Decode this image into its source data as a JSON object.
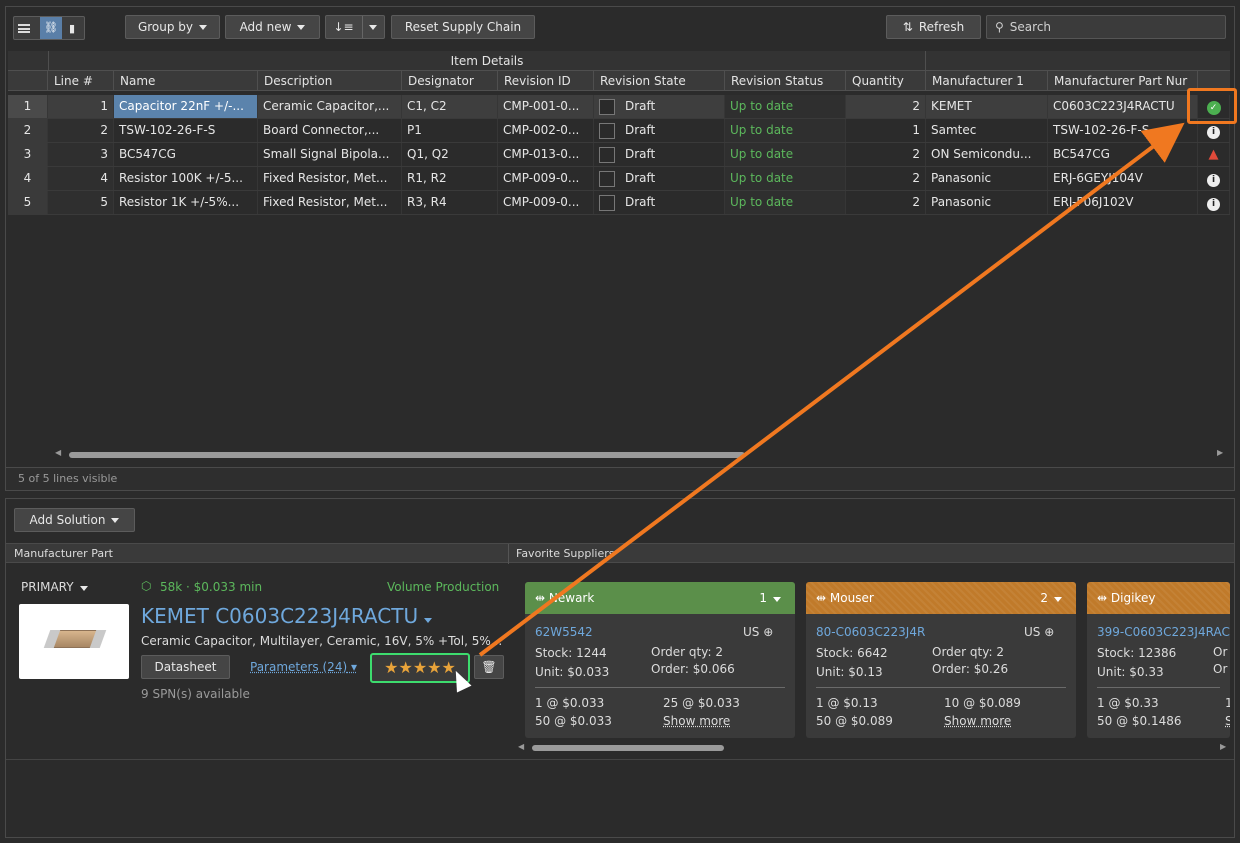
{
  "toolbar": {
    "group_by": "Group by",
    "add_new": "Add new",
    "reset": "Reset Supply Chain",
    "refresh": "Refresh",
    "search_placeholder": "Search"
  },
  "grid": {
    "group_header": "Item Details",
    "columns": [
      "Line #",
      "Name",
      "Description",
      "Designator",
      "Revision ID",
      "Revision State",
      "Revision Status",
      "Quantity",
      "Manufacturer 1",
      "Manufacturer Part Nur"
    ],
    "rows": [
      {
        "idx": "1",
        "line": "1",
        "name": "Capacitor 22nF +/-...",
        "desc": "Ceramic Capacitor,...",
        "des": "C1, C2",
        "rev": "CMP-001-0...",
        "state": "Draft",
        "status": "Up to date",
        "qty": "2",
        "mfr": "KEMET",
        "mpn": "C0603C223J4RACTU",
        "icon": "check"
      },
      {
        "idx": "2",
        "line": "2",
        "name": "TSW-102-26-F-S",
        "desc": "Board Connector,...",
        "des": "P1",
        "rev": "CMP-002-0...",
        "state": "Draft",
        "status": "Up to date",
        "qty": "1",
        "mfr": "Samtec",
        "mpn": "TSW-102-26-F-S",
        "icon": "info"
      },
      {
        "idx": "3",
        "line": "3",
        "name": "BC547CG",
        "desc": "Small Signal Bipola...",
        "des": "Q1, Q2",
        "rev": "CMP-013-0...",
        "state": "Draft",
        "status": "Up to date",
        "qty": "2",
        "mfr": "ON Semicondu...",
        "mpn": "BC547CG",
        "icon": "warning"
      },
      {
        "idx": "4",
        "line": "4",
        "name": "Resistor 100K +/-5...",
        "desc": "Fixed Resistor, Met...",
        "des": "R1, R2",
        "rev": "CMP-009-0...",
        "state": "Draft",
        "status": "Up to date",
        "qty": "2",
        "mfr": "Panasonic",
        "mpn": "ERJ-6GEYJ104V",
        "icon": "info"
      },
      {
        "idx": "5",
        "line": "5",
        "name": "Resistor 1K +/-5%...",
        "desc": "Fixed Resistor, Met...",
        "des": "R3, R4",
        "rev": "CMP-009-0...",
        "state": "Draft",
        "status": "Up to date",
        "qty": "2",
        "mfr": "Panasonic",
        "mpn": "ERJ-P06J102V",
        "icon": "info"
      }
    ],
    "footer": "5 of 5 lines visible"
  },
  "solution": {
    "add_solution": "Add Solution",
    "mfr_part_header": "Manufacturer Part",
    "suppliers_header": "Favorite Suppliers",
    "primary": "PRIMARY",
    "stock_summary": "58k · $0.033 min",
    "lifecycle": "Volume Production",
    "title": "KEMET C0603C223J4RACTU",
    "description": "Ceramic Capacitor, Multilayer, Ceramic, 16V, 5% +Tol, 5%...",
    "datasheet": "Datasheet",
    "parameters": "Parameters (24)",
    "rating": "★★★★★",
    "spn": "9 SPN(s) available",
    "colors": {
      "accent_orange": "#f07820",
      "highlight_green": "#3ddc6e",
      "newark": "#5b8f4a",
      "mouser": "#c07a2a"
    }
  },
  "suppliers": [
    {
      "name": "Newark",
      "rank": "1",
      "spn": "62W5542",
      "region": "US",
      "stock": "Stock: 1244",
      "unit": "Unit: $0.033",
      "order_qty": "Order qty: 2",
      "order": "Order: $0.066",
      "p1": "1 @ $0.033",
      "p2": "25 @ $0.033",
      "p3": "50 @ $0.033",
      "more": "Show more"
    },
    {
      "name": "Mouser",
      "rank": "2",
      "spn": "80-C0603C223J4R",
      "region": "US",
      "stock": "Stock: 6642",
      "unit": "Unit: $0.13",
      "order_qty": "Order qty: 2",
      "order": "Order: $0.26",
      "p1": "1 @ $0.13",
      "p2": "10 @ $0.089",
      "p3": "50 @ $0.089",
      "more": "Show more"
    },
    {
      "name": "Digikey",
      "rank": "",
      "spn": "399-C0603C223J4RAC",
      "region": "",
      "stock": "Stock: 12386",
      "unit": "Unit: $0.33",
      "order_qty": "Or",
      "order": "Or",
      "p1": "1 @ $0.33",
      "p2": "1",
      "p3": "50 @ $0.1486",
      "more": "S"
    }
  ]
}
